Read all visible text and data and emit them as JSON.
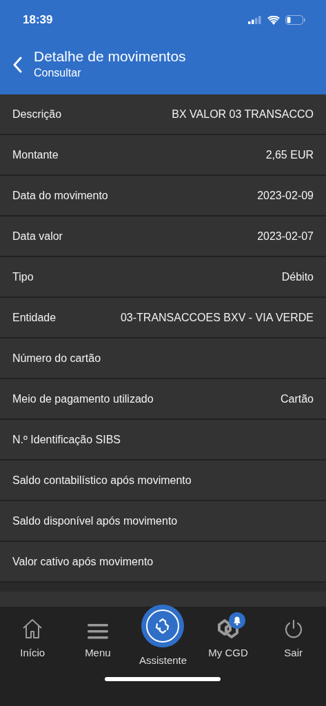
{
  "status_bar": {
    "time": "18:39"
  },
  "header": {
    "title": "Detalhe de movimentos",
    "subtitle": "Consultar"
  },
  "details": [
    {
      "label": "Descrição",
      "value": "BX VALOR 03 TRANSACCO"
    },
    {
      "label": "Montante",
      "value": "2,65 EUR"
    },
    {
      "label": "Data do movimento",
      "value": "2023-02-09"
    },
    {
      "label": "Data valor",
      "value": "2023-02-07"
    },
    {
      "label": "Tipo",
      "value": "Débito"
    },
    {
      "label": "Entidade",
      "value": "03-TRANSACCOES BXV - VIA VERDE"
    },
    {
      "label": "Número do cartão"
    },
    {
      "label": "Meio de pagamento utilizado",
      "value": "Cartão"
    },
    {
      "label": "N.º Identificação SIBS"
    },
    {
      "label": "Saldo contabilístico após movimento"
    },
    {
      "label": "Saldo disponível após movimento"
    },
    {
      "label": "Valor cativo após movimento"
    }
  ],
  "tab_bar": [
    {
      "kind": "home",
      "label": "Início"
    },
    {
      "kind": "menu",
      "label": "Menu"
    },
    {
      "kind": "assistant",
      "label": "Assistente"
    },
    {
      "kind": "mycgd",
      "label": "My CGD"
    },
    {
      "kind": "power",
      "label": "Sair"
    }
  ]
}
